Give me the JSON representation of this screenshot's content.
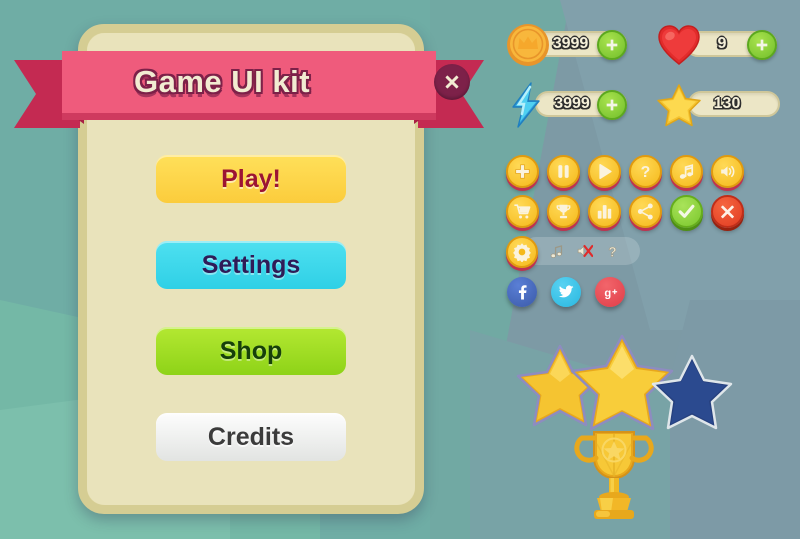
{
  "window": {
    "title": "Game UI kit"
  },
  "dialog": {
    "title": "Game UI kit",
    "close_label": "close-icon",
    "ribbon_color": "#ef5b7c",
    "ribbon_fold_color": "#c42a52",
    "title_color": "#f2ecd2",
    "title_outline_color": "#7d2149",
    "panel_bg": "#e9e3bb",
    "panel_border": "#d5cd93"
  },
  "menu": {
    "buttons": [
      {
        "label": "Play!",
        "face": "#fbcc3c",
        "edge": "#c4294d",
        "text": "#9c1433"
      },
      {
        "label": "Settings",
        "face": "#2fd0e6",
        "edge": "#7b3fc4",
        "text": "#2f1b57"
      },
      {
        "label": "Shop",
        "face": "#8ed318",
        "edge": "#2d7f96",
        "text": "#16400a"
      },
      {
        "label": "Credits",
        "face": "#e2e4e2",
        "edge": "#6d6d6d",
        "text": "#3b3b3b"
      }
    ]
  },
  "resources": [
    {
      "icon": "coin-icon",
      "value": "3999",
      "has_plus": true
    },
    {
      "icon": "heart-icon",
      "value": "9",
      "has_plus": true
    },
    {
      "icon": "lightning-icon",
      "value": "3999",
      "has_plus": true
    },
    {
      "icon": "star-icon",
      "value": "130",
      "has_plus": false
    }
  ],
  "icon_buttons": {
    "row1": [
      {
        "name": "plus-icon",
        "style": "yellow"
      },
      {
        "name": "pause-icon",
        "style": "yellow"
      },
      {
        "name": "play-icon",
        "style": "yellow"
      },
      {
        "name": "question-icon",
        "style": "yellow"
      },
      {
        "name": "music-note-icon",
        "style": "yellow"
      },
      {
        "name": "sound-wave-icon",
        "style": "yellow"
      }
    ],
    "row2": [
      {
        "name": "shopping-cart-icon",
        "style": "yellow"
      },
      {
        "name": "trophy-icon",
        "style": "yellow"
      },
      {
        "name": "bar-chart-icon",
        "style": "yellow"
      },
      {
        "name": "share-icon",
        "style": "yellow"
      },
      {
        "name": "check-icon",
        "style": "green"
      },
      {
        "name": "close-x-icon",
        "style": "red"
      }
    ]
  },
  "settings_panel": {
    "gear": "gear-icon",
    "items": [
      {
        "name": "music-on-icon"
      },
      {
        "name": "sound-off-icon"
      },
      {
        "name": "help-icon"
      }
    ]
  },
  "social": [
    {
      "name": "facebook-icon",
      "color": "#3b5aa8",
      "glyph": "f"
    },
    {
      "name": "twitter-icon",
      "color": "#29b8e0",
      "glyph": ""
    },
    {
      "name": "googleplus-icon",
      "color": "#e03d48",
      "glyph": "g+"
    }
  ],
  "rating": {
    "stars": [
      {
        "state": "filled",
        "color": "#f5c431"
      },
      {
        "state": "filled",
        "color": "#f8cd3a"
      },
      {
        "state": "empty",
        "color": "#26407e"
      }
    ],
    "trophy": {
      "name": "trophy-award-icon",
      "color": "#f2b727"
    }
  },
  "background": {
    "primary": "#6fada5",
    "secondary": "#7d9aa5",
    "accent": "#74b8a6"
  }
}
